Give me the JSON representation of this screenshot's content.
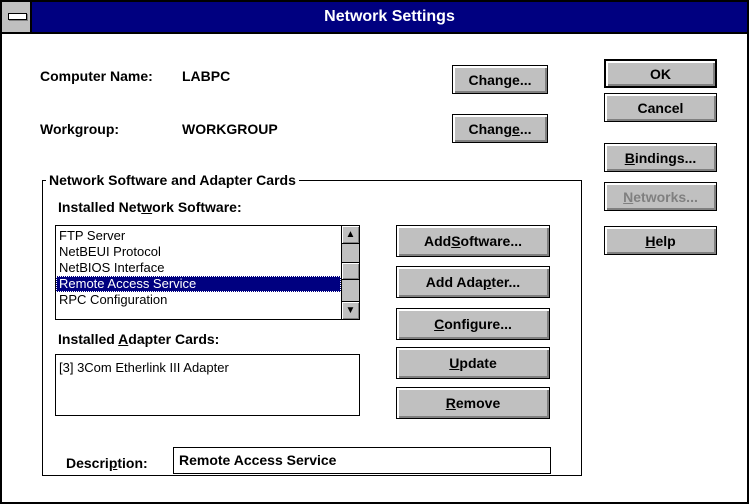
{
  "window": {
    "title": "Network Settings"
  },
  "computer_name": {
    "label": "Computer Name:",
    "value": "LABPC",
    "change_pre": "Chan",
    "change_key": "g",
    "change_post": "e..."
  },
  "workgroup": {
    "label": "Workgroup:",
    "value": "WORKGROUP",
    "change_pre": "Chang",
    "change_key": "e",
    "change_post": "..."
  },
  "side_buttons": {
    "ok": "OK",
    "cancel": "Cancel",
    "bindings_key": "B",
    "bindings_rest": "indings...",
    "networks_key": "N",
    "networks_rest": "etworks...",
    "help_key": "H",
    "help_rest": "elp"
  },
  "group": {
    "title": "Network Software and Adapter Cards"
  },
  "software": {
    "label_pre": "Installed Net",
    "label_key": "w",
    "label_post": "ork Software:",
    "items": [
      "FTP Server",
      "NetBEUI Protocol",
      "NetBIOS Interface",
      "Remote Access Service",
      "RPC Configuration"
    ],
    "selected_index": 3
  },
  "adapters": {
    "label_pre": "Installed ",
    "label_key": "A",
    "label_post": "dapter Cards:",
    "items": [
      "[3] 3Com Etherlink III Adapter"
    ]
  },
  "actions": {
    "add_software_pre": "Add ",
    "add_software_key": "S",
    "add_software_post": "oftware...",
    "add_adapter_pre": "Add Ada",
    "add_adapter_key": "p",
    "add_adapter_post": "ter...",
    "configure_key": "C",
    "configure_rest": "onfigure...",
    "update_key": "U",
    "update_rest": "pdate",
    "remove_key": "R",
    "remove_rest": "emove"
  },
  "description": {
    "label_pre": "Descri",
    "label_key": "p",
    "label_post": "tion:",
    "value": "Remote Access Service"
  }
}
